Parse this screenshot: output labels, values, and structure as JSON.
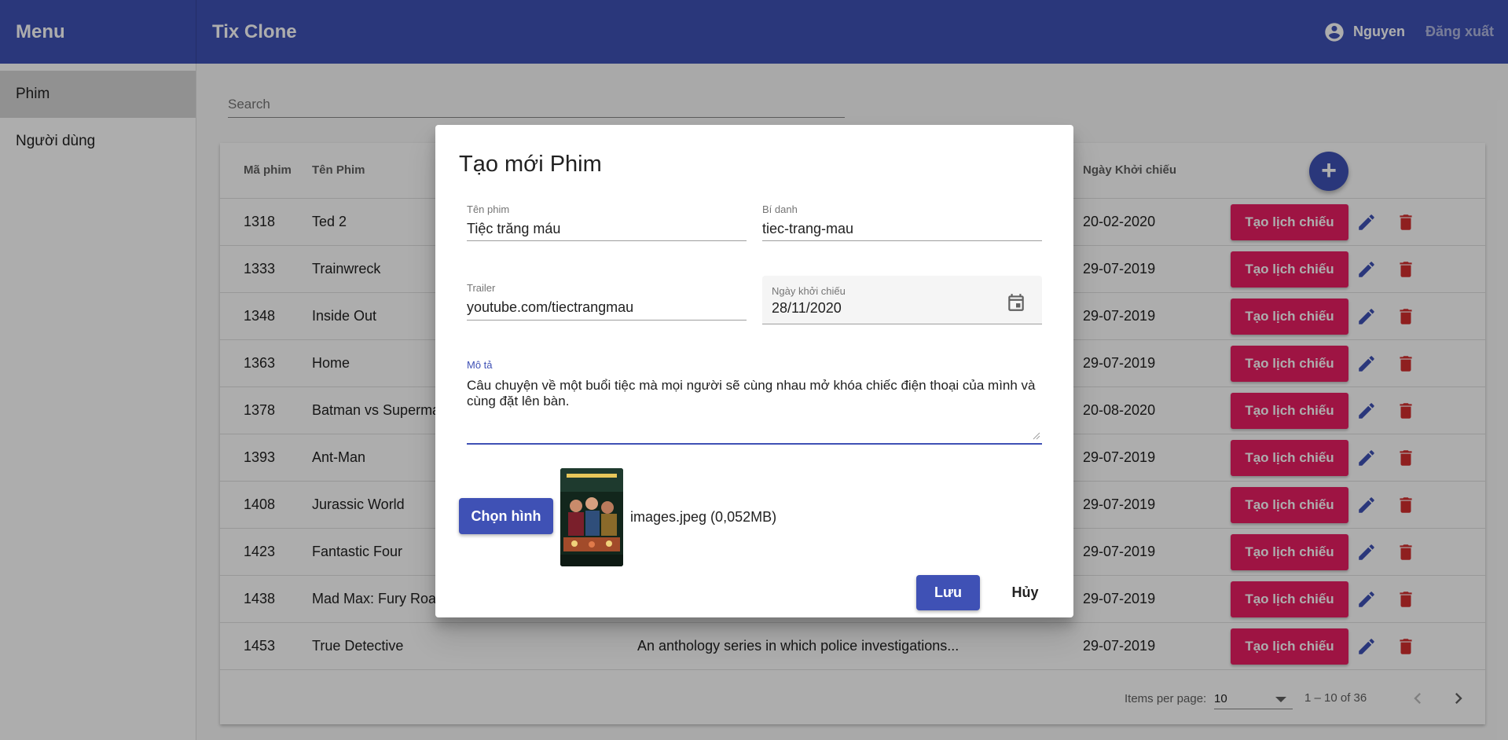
{
  "header": {
    "menu_title": "Menu",
    "app_title": "Tix Clone",
    "user_name": "Nguyen",
    "logout": "Đăng xuất"
  },
  "sidebar": {
    "items": [
      {
        "label": "Phim"
      },
      {
        "label": "Người dùng"
      }
    ]
  },
  "search": {
    "placeholder": "Search"
  },
  "table": {
    "columns": {
      "id": "Mã phim",
      "name": "Tên Phim",
      "date": "Ngày Khởi chiếu"
    },
    "add_symbol": "+",
    "action_label": "Tạo lịch chiếu",
    "rows": [
      {
        "id": "1318",
        "name": "Ted 2",
        "desc": "",
        "date": "20-02-2020"
      },
      {
        "id": "1333",
        "name": "Trainwreck",
        "desc": "",
        "date": "29-07-2019"
      },
      {
        "id": "1348",
        "name": "Inside Out",
        "desc": "",
        "date": "29-07-2019"
      },
      {
        "id": "1363",
        "name": "Home",
        "desc": "",
        "date": "29-07-2019"
      },
      {
        "id": "1378",
        "name": "Batman vs Superma",
        "desc": "",
        "date": "20-08-2020"
      },
      {
        "id": "1393",
        "name": "Ant-Man",
        "desc": "",
        "date": "29-07-2019"
      },
      {
        "id": "1408",
        "name": "Jurassic World",
        "desc": "",
        "date": "29-07-2019"
      },
      {
        "id": "1423",
        "name": "Fantastic Four",
        "desc": "",
        "date": "29-07-2019"
      },
      {
        "id": "1438",
        "name": "Mad Max: Fury Road",
        "desc": "",
        "date": "29-07-2019"
      },
      {
        "id": "1453",
        "name": "True Detective",
        "desc": "An anthology series in which police investigations...",
        "date": "29-07-2019"
      }
    ]
  },
  "paginator": {
    "items_label": "Items per page:",
    "page_size": "10",
    "range": "1 – 10 of 36"
  },
  "dialog": {
    "title": "Tạo mới Phim",
    "ten_phim": {
      "label": "Tên phim",
      "value": "Tiệc trăng máu"
    },
    "bi_danh": {
      "label": "Bí danh",
      "value": "tiec-trang-mau"
    },
    "trailer": {
      "label": "Trailer",
      "value": "youtube.com/tiectrangmau"
    },
    "ngay_khoi_chieu": {
      "label": "Ngày khởi chiếu",
      "value": "28/11/2020"
    },
    "mo_ta": {
      "label": "Mô tả",
      "value": "Câu chuyện về một buổi tiệc mà mọi người sẽ cùng nhau mở khóa chiếc điện thoại của mình và cùng đặt lên bàn."
    },
    "choose_image": "Chọn hình",
    "file_info": "images.jpeg (0,052MB)",
    "save": "Lưu",
    "cancel": "Hủy"
  },
  "colors": {
    "primary": "#3f51b5",
    "accent": "#e91e63",
    "warn": "#d32f2f"
  },
  "icons": {
    "user": "account-circle-icon",
    "add": "plus-icon",
    "edit": "pencil-icon",
    "delete": "trash-icon",
    "calendar": "calendar-icon"
  }
}
